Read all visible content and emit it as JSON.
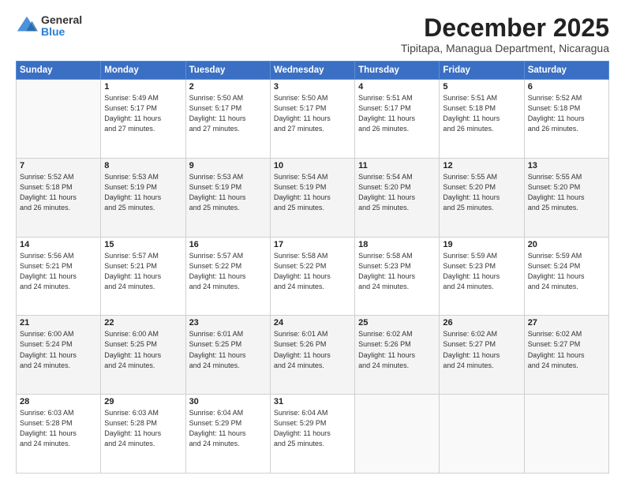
{
  "header": {
    "logo_general": "General",
    "logo_blue": "Blue",
    "month_title": "December 2025",
    "subtitle": "Tipitapa, Managua Department, Nicaragua"
  },
  "days_of_week": [
    "Sunday",
    "Monday",
    "Tuesday",
    "Wednesday",
    "Thursday",
    "Friday",
    "Saturday"
  ],
  "weeks": [
    [
      {
        "num": "",
        "info": ""
      },
      {
        "num": "1",
        "info": "Sunrise: 5:49 AM\nSunset: 5:17 PM\nDaylight: 11 hours\nand 27 minutes."
      },
      {
        "num": "2",
        "info": "Sunrise: 5:50 AM\nSunset: 5:17 PM\nDaylight: 11 hours\nand 27 minutes."
      },
      {
        "num": "3",
        "info": "Sunrise: 5:50 AM\nSunset: 5:17 PM\nDaylight: 11 hours\nand 27 minutes."
      },
      {
        "num": "4",
        "info": "Sunrise: 5:51 AM\nSunset: 5:17 PM\nDaylight: 11 hours\nand 26 minutes."
      },
      {
        "num": "5",
        "info": "Sunrise: 5:51 AM\nSunset: 5:18 PM\nDaylight: 11 hours\nand 26 minutes."
      },
      {
        "num": "6",
        "info": "Sunrise: 5:52 AM\nSunset: 5:18 PM\nDaylight: 11 hours\nand 26 minutes."
      }
    ],
    [
      {
        "num": "7",
        "info": "Sunrise: 5:52 AM\nSunset: 5:18 PM\nDaylight: 11 hours\nand 26 minutes."
      },
      {
        "num": "8",
        "info": "Sunrise: 5:53 AM\nSunset: 5:19 PM\nDaylight: 11 hours\nand 25 minutes."
      },
      {
        "num": "9",
        "info": "Sunrise: 5:53 AM\nSunset: 5:19 PM\nDaylight: 11 hours\nand 25 minutes."
      },
      {
        "num": "10",
        "info": "Sunrise: 5:54 AM\nSunset: 5:19 PM\nDaylight: 11 hours\nand 25 minutes."
      },
      {
        "num": "11",
        "info": "Sunrise: 5:54 AM\nSunset: 5:20 PM\nDaylight: 11 hours\nand 25 minutes."
      },
      {
        "num": "12",
        "info": "Sunrise: 5:55 AM\nSunset: 5:20 PM\nDaylight: 11 hours\nand 25 minutes."
      },
      {
        "num": "13",
        "info": "Sunrise: 5:55 AM\nSunset: 5:20 PM\nDaylight: 11 hours\nand 25 minutes."
      }
    ],
    [
      {
        "num": "14",
        "info": "Sunrise: 5:56 AM\nSunset: 5:21 PM\nDaylight: 11 hours\nand 24 minutes."
      },
      {
        "num": "15",
        "info": "Sunrise: 5:57 AM\nSunset: 5:21 PM\nDaylight: 11 hours\nand 24 minutes."
      },
      {
        "num": "16",
        "info": "Sunrise: 5:57 AM\nSunset: 5:22 PM\nDaylight: 11 hours\nand 24 minutes."
      },
      {
        "num": "17",
        "info": "Sunrise: 5:58 AM\nSunset: 5:22 PM\nDaylight: 11 hours\nand 24 minutes."
      },
      {
        "num": "18",
        "info": "Sunrise: 5:58 AM\nSunset: 5:23 PM\nDaylight: 11 hours\nand 24 minutes."
      },
      {
        "num": "19",
        "info": "Sunrise: 5:59 AM\nSunset: 5:23 PM\nDaylight: 11 hours\nand 24 minutes."
      },
      {
        "num": "20",
        "info": "Sunrise: 5:59 AM\nSunset: 5:24 PM\nDaylight: 11 hours\nand 24 minutes."
      }
    ],
    [
      {
        "num": "21",
        "info": "Sunrise: 6:00 AM\nSunset: 5:24 PM\nDaylight: 11 hours\nand 24 minutes."
      },
      {
        "num": "22",
        "info": "Sunrise: 6:00 AM\nSunset: 5:25 PM\nDaylight: 11 hours\nand 24 minutes."
      },
      {
        "num": "23",
        "info": "Sunrise: 6:01 AM\nSunset: 5:25 PM\nDaylight: 11 hours\nand 24 minutes."
      },
      {
        "num": "24",
        "info": "Sunrise: 6:01 AM\nSunset: 5:26 PM\nDaylight: 11 hours\nand 24 minutes."
      },
      {
        "num": "25",
        "info": "Sunrise: 6:02 AM\nSunset: 5:26 PM\nDaylight: 11 hours\nand 24 minutes."
      },
      {
        "num": "26",
        "info": "Sunrise: 6:02 AM\nSunset: 5:27 PM\nDaylight: 11 hours\nand 24 minutes."
      },
      {
        "num": "27",
        "info": "Sunrise: 6:02 AM\nSunset: 5:27 PM\nDaylight: 11 hours\nand 24 minutes."
      }
    ],
    [
      {
        "num": "28",
        "info": "Sunrise: 6:03 AM\nSunset: 5:28 PM\nDaylight: 11 hours\nand 24 minutes."
      },
      {
        "num": "29",
        "info": "Sunrise: 6:03 AM\nSunset: 5:28 PM\nDaylight: 11 hours\nand 24 minutes."
      },
      {
        "num": "30",
        "info": "Sunrise: 6:04 AM\nSunset: 5:29 PM\nDaylight: 11 hours\nand 24 minutes."
      },
      {
        "num": "31",
        "info": "Sunrise: 6:04 AM\nSunset: 5:29 PM\nDaylight: 11 hours\nand 25 minutes."
      },
      {
        "num": "",
        "info": ""
      },
      {
        "num": "",
        "info": ""
      },
      {
        "num": "",
        "info": ""
      }
    ]
  ]
}
